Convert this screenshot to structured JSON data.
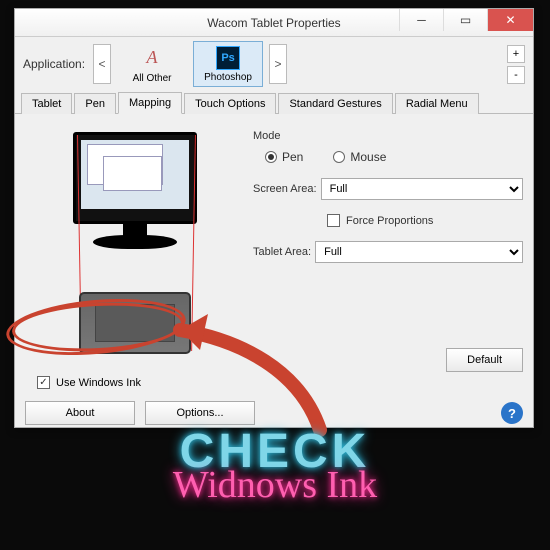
{
  "window": {
    "title": "Wacom Tablet Properties"
  },
  "application": {
    "label": "Application:",
    "prev": "<",
    "next": ">",
    "items": [
      {
        "label": "All Other",
        "selected": false
      },
      {
        "label": "Photoshop",
        "selected": true
      }
    ],
    "add": "+",
    "remove": "-"
  },
  "tabs": {
    "items": [
      "Tablet",
      "Pen",
      "Mapping",
      "Touch Options",
      "Standard Gestures",
      "Radial Menu"
    ],
    "active": "Mapping"
  },
  "mapping": {
    "mode": {
      "label": "Mode",
      "pen_label": "Pen",
      "mouse_label": "Mouse",
      "selected": "Pen"
    },
    "screen_area": {
      "label": "Screen Area:",
      "value": "Full"
    },
    "force_proportions": {
      "label": "Force Proportions",
      "checked": false
    },
    "tablet_area": {
      "label": "Tablet Area:",
      "value": "Full"
    },
    "default_btn": "Default",
    "use_windows_ink": {
      "label": "Use Windows Ink",
      "checked": true
    }
  },
  "footer": {
    "about": "About",
    "options": "Options...",
    "help": "?"
  },
  "annotation": {
    "line1": "CHECK",
    "line2": "Widnows Ink"
  }
}
